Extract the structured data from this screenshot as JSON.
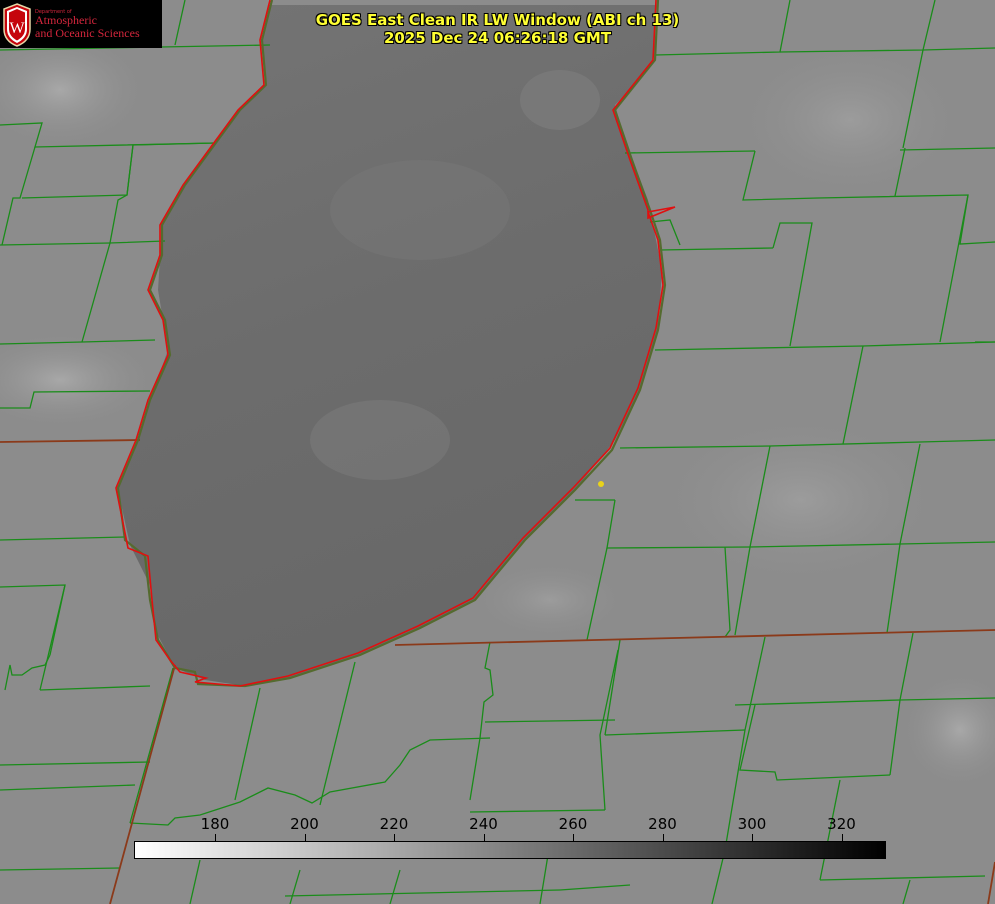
{
  "logo": {
    "department": "Department of",
    "line1": "Atmospheric",
    "line2": "and Oceanic Sciences",
    "seal_letter": "W",
    "text_color": "#d4263c"
  },
  "title": {
    "line1": "GOES East Clean IR LW Window (ABI ch 13)",
    "line2": "2025 Dec 24 06:26:18 GMT",
    "color": "#ffff33"
  },
  "colorbar": {
    "ticks": [
      "180",
      "200",
      "220",
      "240",
      "260",
      "280",
      "300",
      "320"
    ],
    "gradient_start": "#ffffff",
    "gradient_end": "#000000"
  },
  "map": {
    "boundary_color": "#1a8c1a",
    "coastline_color": "#e01010",
    "state_line_color": "#8b3a1a",
    "marker_color": "#e8d21a",
    "land_color": "#8c8c8c",
    "lake_color": "#6a6a6a"
  }
}
